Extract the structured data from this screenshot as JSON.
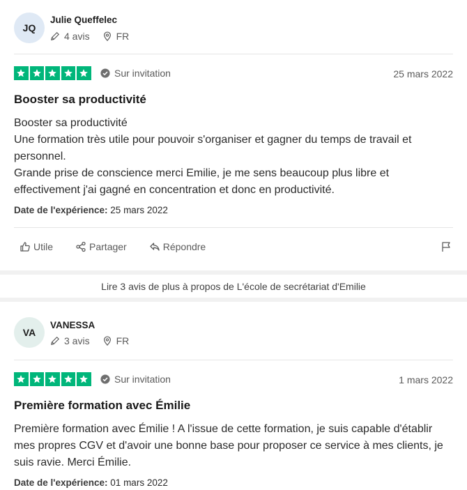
{
  "reviews": [
    {
      "initials": "JQ",
      "avatar_color": "#dfe9f5",
      "name": "Julie Queffelec",
      "review_count": "4 avis",
      "country": "FR",
      "stars": 5,
      "verification": "Sur invitation",
      "date": "25 mars 2022",
      "title": "Booster sa productivité",
      "body": [
        "Booster sa productivité",
        "Une formation très utile pour pouvoir s'organiser et gagner du temps de travail et personnel.",
        "Grande prise de conscience merci Emilie, je me sens beaucoup plus libre et effectivement j'ai gagné en concentration et donc en productivité."
      ],
      "experience_label": "Date de l'expérience:",
      "experience_date": "25 mars 2022",
      "actions": {
        "useful": "Utile",
        "share": "Partager",
        "reply": "Répondre"
      }
    },
    {
      "initials": "VA",
      "avatar_color": "#e3efec",
      "name": "VANESSA",
      "review_count": "3 avis",
      "country": "FR",
      "stars": 5,
      "verification": "Sur invitation",
      "date": "1 mars 2022",
      "title": "Première formation avec Émilie",
      "body": [
        "Première formation avec Émilie ! A l'issue de cette formation, je suis capable d'établir mes propres CGV et d'avoir une bonne base pour proposer ce service à mes clients, je suis ravie. Merci Émilie."
      ],
      "experience_label": "Date de l'expérience:",
      "experience_date": "01 mars 2022"
    }
  ],
  "more_reviews_link": "Lire 3 avis de plus à propos de L'école de secrétariat d'Emilie",
  "colors": {
    "star_green": "#00b67a",
    "divider": "#e5e5e5"
  }
}
